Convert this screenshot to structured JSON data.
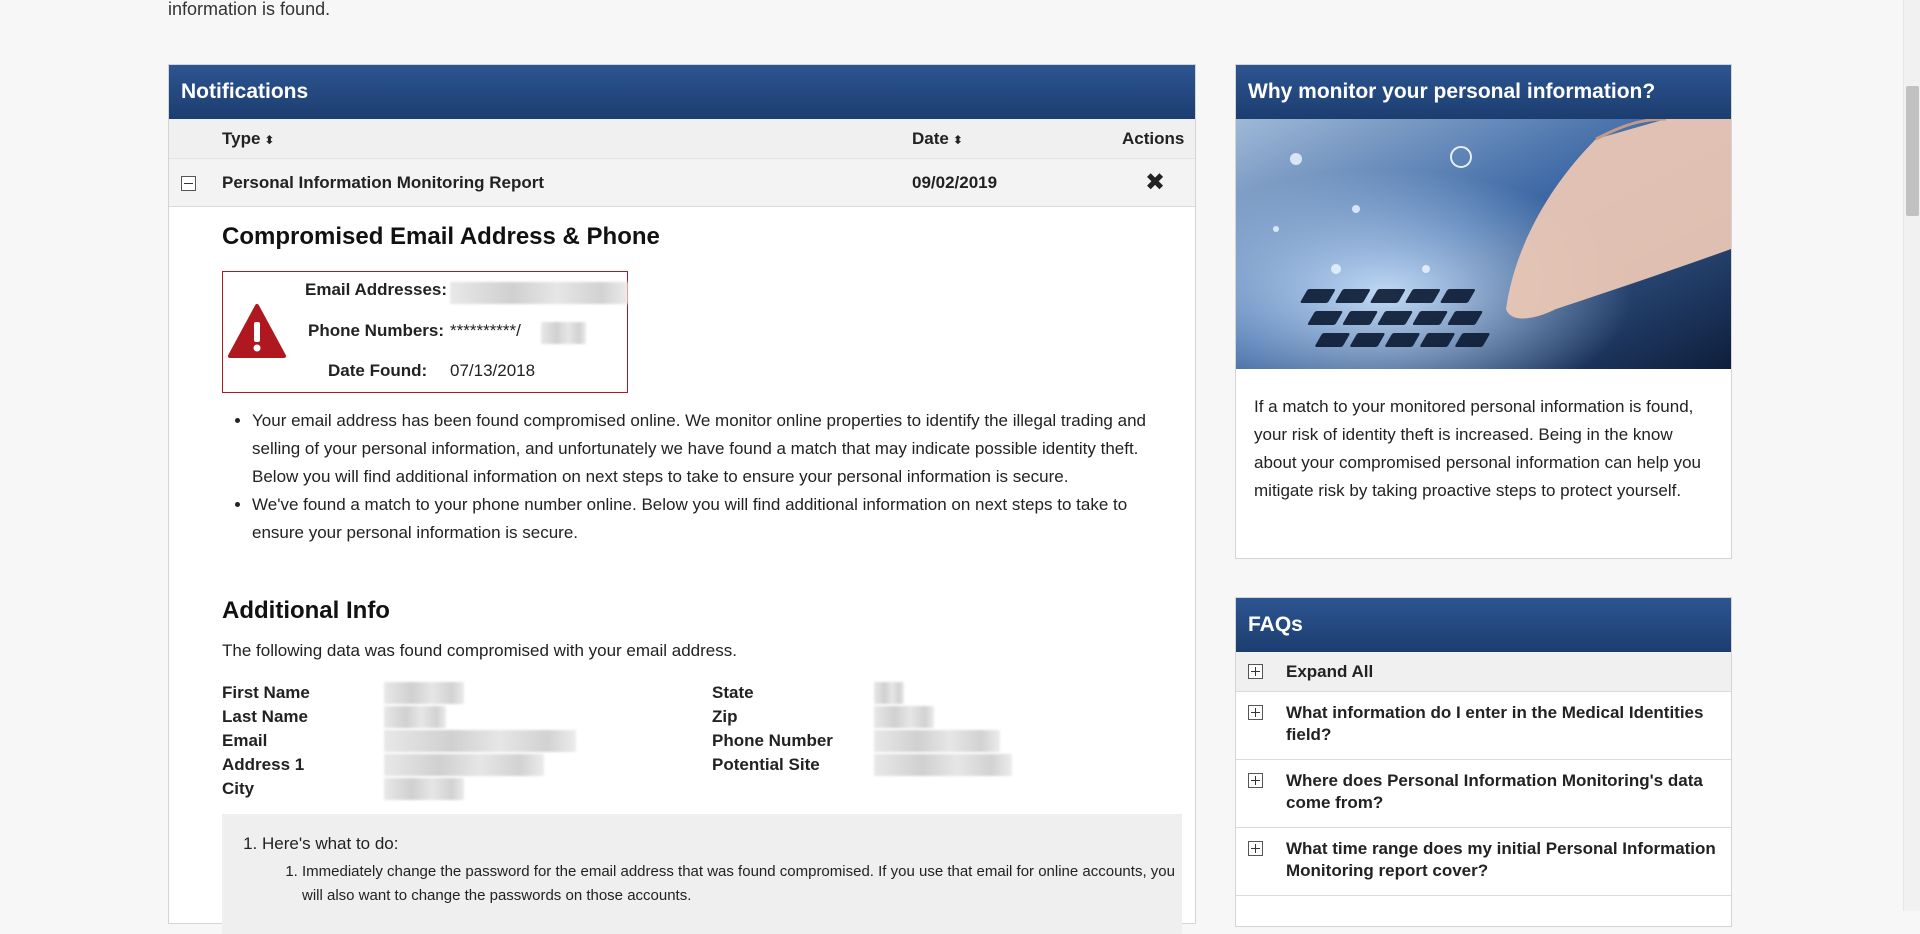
{
  "top_text": "information is found.",
  "notifications": {
    "title": "Notifications",
    "columns": {
      "type": "Type",
      "date": "Date",
      "actions": "Actions"
    },
    "sort_glyph": "⬍",
    "row": {
      "type": "Personal Information Monitoring Report",
      "date": "09/02/2019",
      "close_glyph": "✖"
    },
    "detail": {
      "heading": "Compromised Email Address & Phone",
      "alert": {
        "email_label": "Email Addresses:",
        "phone_label": "Phone Numbers:",
        "phone_value": "**********/",
        "date_label": "Date Found:",
        "date_value": "07/13/2018"
      },
      "bullets": [
        "Your email address has been found compromised online. We monitor online properties to identify the illegal trading and selling of your personal information, and unfortunately we have found a match that may indicate possible identity theft. Below you will find additional information on next steps to take to ensure your personal information is secure.",
        "We've found a match to your phone number online. Below you will find additional information on next steps to take to ensure your personal information is secure."
      ],
      "additional_title": "Additional Info",
      "additional_sub": "The following data was found compromised with your email address.",
      "left_fields": [
        "First Name",
        "Last Name",
        "Email",
        "Address 1",
        "City"
      ],
      "right_fields": [
        "State",
        "Zip",
        "Phone Number",
        "Potential Site"
      ],
      "todo_title": "Here's what to do:",
      "todo_items": [
        "Immediately change the password for the email address that was found compromised. If you use that email for online accounts, you will also want to change the passwords on those accounts."
      ]
    }
  },
  "why": {
    "title": "Why monitor your personal information?",
    "text": "If a match to your monitored personal information is found, your risk of identity theft is increased. Being in the know about your compromised personal information can help you mitigate risk by taking proactive steps to protect yourself."
  },
  "faqs": {
    "title": "FAQs",
    "items": [
      "Expand All",
      "What information do I enter in the Medical Identities field?",
      "Where does Personal Information Monitoring's data come from?",
      "What time range does my initial Personal Information Monitoring report cover?"
    ]
  },
  "colors": {
    "header_blue": "#1c3d6f",
    "alert_red": "#b01820"
  }
}
